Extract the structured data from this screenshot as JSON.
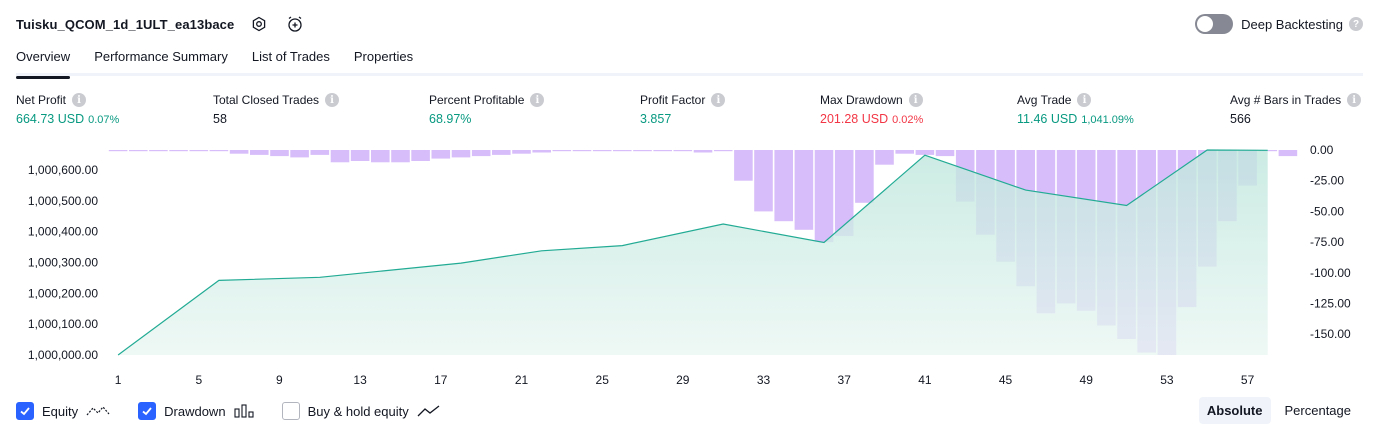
{
  "header": {
    "title": "Tuisku_QCOM_1d_1ULT_ea13bace"
  },
  "deep_backtesting": {
    "label": "Deep Backtesting",
    "enabled": false
  },
  "tabs": [
    {
      "label": "Overview",
      "active": true
    },
    {
      "label": "Performance Summary",
      "active": false
    },
    {
      "label": "List of Trades",
      "active": false
    },
    {
      "label": "Properties",
      "active": false
    }
  ],
  "metrics": {
    "net_profit": {
      "label": "Net Profit",
      "value": "664.73 USD",
      "pct": "0.07%"
    },
    "total_closed_trades": {
      "label": "Total Closed Trades",
      "value": "58"
    },
    "percent_profitable": {
      "label": "Percent Profitable",
      "value": "68.97%"
    },
    "profit_factor": {
      "label": "Profit Factor",
      "value": "3.857"
    },
    "max_drawdown": {
      "label": "Max Drawdown",
      "value": "201.28 USD",
      "pct": "0.02%"
    },
    "avg_trade": {
      "label": "Avg Trade",
      "value": "11.46 USD",
      "pct": "1,041.09%"
    },
    "avg_bars": {
      "label": "Avg # Bars in Trades",
      "value": "566"
    }
  },
  "colors": {
    "equity_line": "#22ab94",
    "equity_fill": "#d7f0ea",
    "drawdown_bar": "#c9a7f7",
    "positive": "#089981",
    "negative": "#f23645"
  },
  "chart_data": {
    "type": "area",
    "x_ticks": [
      "1",
      "5",
      "9",
      "13",
      "17",
      "21",
      "25",
      "29",
      "33",
      "37",
      "41",
      "45",
      "49",
      "53",
      "57"
    ],
    "left_axis": {
      "ticks": [
        "1,000,000.00",
        "1,000,100.00",
        "1,000,200.00",
        "1,000,300.00",
        "1,000,400.00",
        "1,000,500.00",
        "1,000,600.00"
      ],
      "ylim": [
        1000000,
        1000665
      ]
    },
    "right_axis": {
      "ticks": [
        "0.00",
        "-25.00",
        "-50.00",
        "-75.00",
        "-100.00",
        "-125.00",
        "-150.00"
      ],
      "ylim": [
        -167,
        0
      ]
    },
    "series": [
      {
        "name": "Equity",
        "type": "area",
        "points": [
          [
            1,
            1000000
          ],
          [
            6,
            1000242
          ],
          [
            11,
            1000252
          ],
          [
            14,
            1000272
          ],
          [
            18,
            1000298
          ],
          [
            22,
            1000338
          ],
          [
            26,
            1000355
          ],
          [
            31,
            1000425
          ],
          [
            36,
            1000365
          ],
          [
            41,
            1000648
          ],
          [
            46,
            1000535
          ],
          [
            51,
            1000485
          ],
          [
            55,
            1000665
          ],
          [
            58,
            1000664
          ]
        ]
      },
      {
        "name": "Drawdown",
        "type": "bar",
        "x": [
          1,
          2,
          3,
          4,
          5,
          6,
          7,
          8,
          9,
          10,
          11,
          12,
          13,
          14,
          15,
          16,
          17,
          18,
          19,
          20,
          21,
          22,
          23,
          24,
          25,
          26,
          27,
          28,
          29,
          30,
          31,
          32,
          33,
          34,
          35,
          36,
          37,
          38,
          39,
          40,
          41,
          42,
          43,
          44,
          45,
          46,
          47,
          48,
          49,
          50,
          51,
          52,
          53,
          54,
          55,
          56,
          57,
          58,
          59
        ],
        "values": [
          -1,
          -1,
          -1,
          -1,
          -1,
          -1,
          -3,
          -4,
          -5,
          -6,
          -4,
          -10,
          -9,
          -10,
          -10,
          -9,
          -7,
          -6,
          -5,
          -4,
          -3,
          -2,
          -1,
          -1,
          -1,
          -1,
          -1,
          -1,
          -1,
          -2,
          -1,
          -25,
          -50,
          -58,
          -65,
          -75,
          -70,
          -43,
          -12,
          -3,
          -4,
          -5,
          -42,
          -69,
          -91,
          -111,
          -133,
          -125,
          -131,
          -143,
          -154,
          -165,
          -167,
          -128,
          -95,
          -58,
          -29,
          -1,
          -5
        ]
      }
    ]
  },
  "legend": [
    {
      "label": "Equity",
      "checked": true,
      "icon": "equity-line-icon"
    },
    {
      "label": "Drawdown",
      "checked": true,
      "icon": "drawdown-bars-icon"
    },
    {
      "label": "Buy & hold equity",
      "checked": false,
      "icon": "buy-hold-line-icon"
    }
  ],
  "mode": {
    "absolute": "Absolute",
    "percentage": "Percentage",
    "active": "absolute"
  }
}
